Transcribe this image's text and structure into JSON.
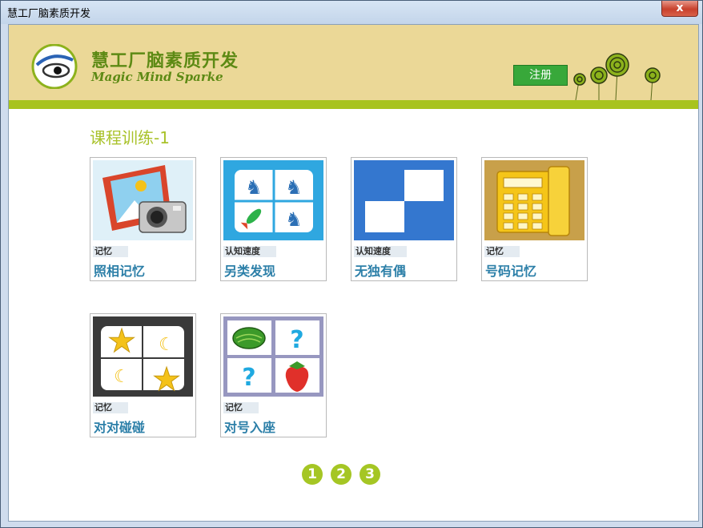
{
  "window": {
    "title": "慧工厂脑素质开发",
    "close_label": "x"
  },
  "header": {
    "brand_cn": "慧工厂脑素质开发",
    "brand_en": "Magic Mind Sparke",
    "register_label": "注册",
    "accent_color": "#a8c31e"
  },
  "main": {
    "section_title": "课程训练-1",
    "cards": [
      {
        "tag": "记忆",
        "name": "照相记忆",
        "icon": "camera-picture-icon"
      },
      {
        "tag": "认知速度",
        "name": "另类发现",
        "icon": "horse-rocket-grid-icon"
      },
      {
        "tag": "认知速度",
        "name": "无独有偶",
        "icon": "blue-squares-icon"
      },
      {
        "tag": "记忆",
        "name": "号码记忆",
        "icon": "telephone-icon"
      },
      {
        "tag": "记忆",
        "name": "对对碰碰",
        "icon": "star-moon-grid-icon"
      },
      {
        "tag": "记忆",
        "name": "对号入座",
        "icon": "fruit-grid-icon"
      }
    ]
  },
  "pager": {
    "pages": [
      "1",
      "2",
      "3"
    ]
  }
}
